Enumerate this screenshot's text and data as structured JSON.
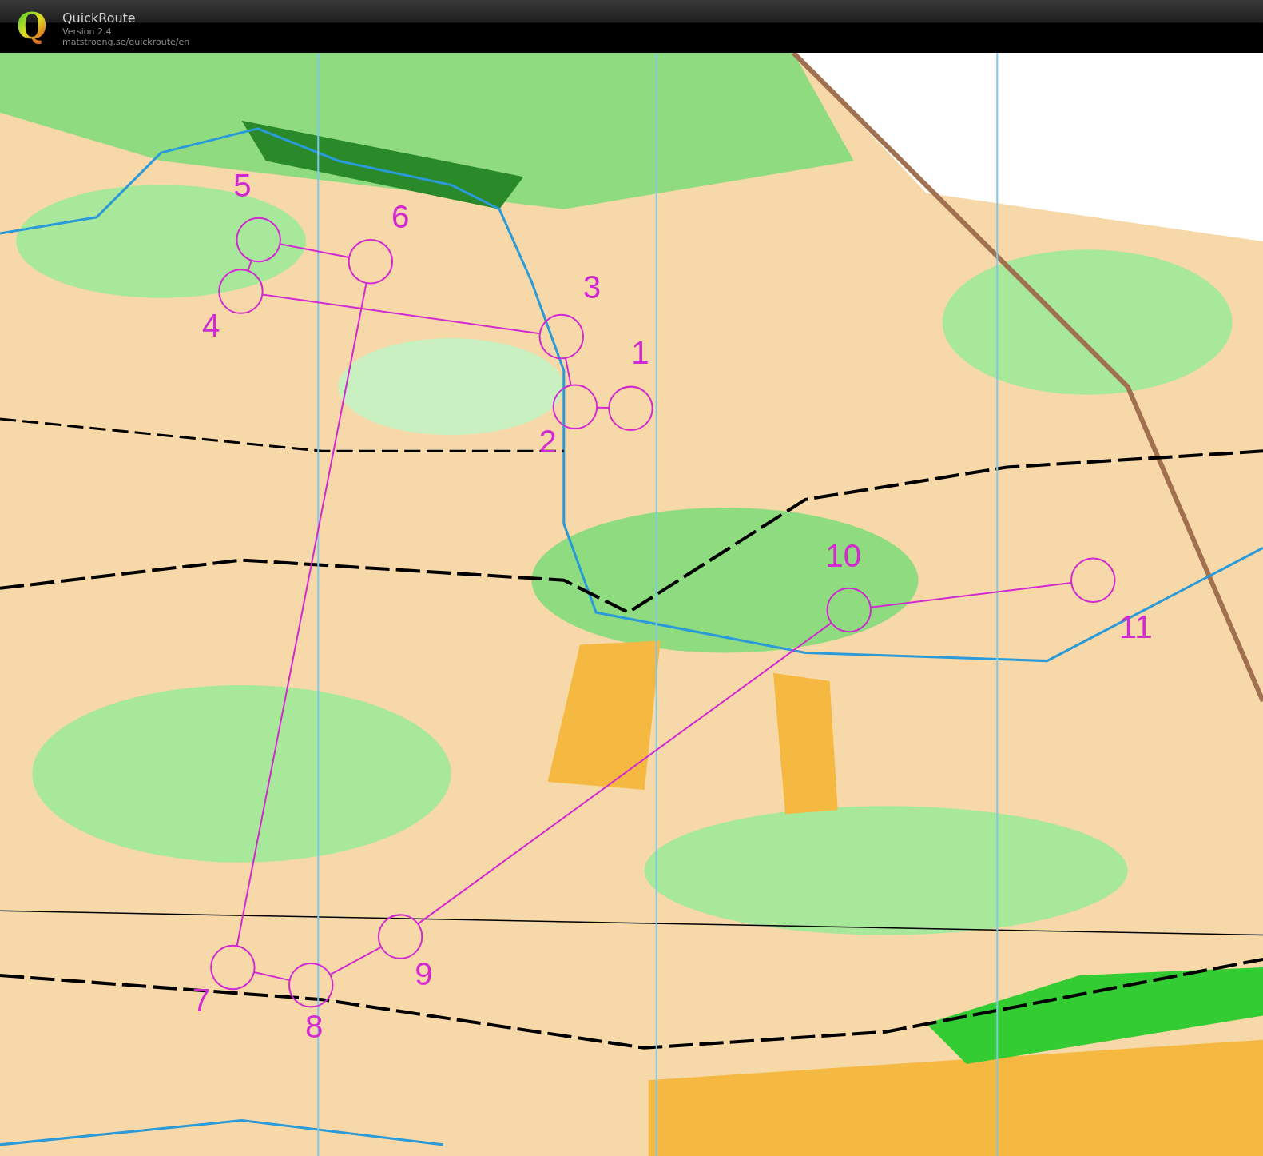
{
  "header": {
    "logo": "Q",
    "title": "QuickRoute",
    "version": "Version 2.4",
    "url": "matstroeng.se/quickroute/en"
  },
  "map": {
    "course": {
      "controls": [
        {
          "label": "1"
        },
        {
          "label": "2"
        },
        {
          "label": "3"
        },
        {
          "label": "4"
        },
        {
          "label": "5"
        },
        {
          "label": "6"
        },
        {
          "label": "7"
        },
        {
          "label": "8"
        },
        {
          "label": "9"
        },
        {
          "label": "10"
        },
        {
          "label": "11"
        }
      ]
    }
  }
}
